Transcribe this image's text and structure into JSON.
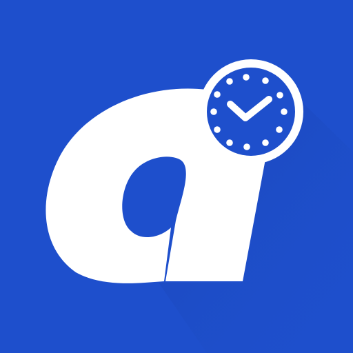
{
  "icon": {
    "name": "app-logo-with-clock",
    "shape": "stylized-letter-a-icon",
    "badge": "clock-check-icon"
  },
  "colors": {
    "background": "#1E4FCC",
    "shadow": "#1741A8",
    "glyph": "#FFFFFF",
    "badge_fill": "#1E4FCC",
    "badge_ring": "#FFFFFF"
  }
}
